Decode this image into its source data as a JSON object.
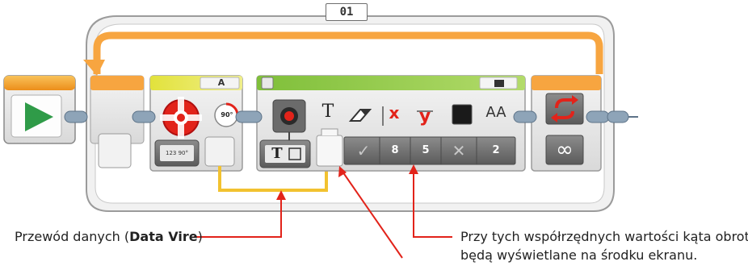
{
  "loop": {
    "label": "01"
  },
  "motor_block": {
    "port": "A",
    "degrees_badge": "90°",
    "mode_icon_text": "123 90°"
  },
  "display_block": {
    "header_icon": "brick-display-icon",
    "mode_letter": "T",
    "params": [
      {
        "icon": "T",
        "value": ""
      },
      {
        "icon": "eraser",
        "value": "✓"
      },
      {
        "icon": "x",
        "value": "8"
      },
      {
        "icon": "y",
        "value": "5"
      },
      {
        "icon": "color",
        "value": "✕"
      },
      {
        "icon": "AA",
        "value": "2"
      }
    ]
  },
  "end_block": {
    "icon": "loop-interrupt-icon",
    "value": "∞"
  },
  "captions": {
    "wire_prefix": "Przewód danych (",
    "wire_bold": "Data Vire",
    "wire_suffix": ")",
    "coords_line1": "Przy tych współrzędnych wartości kąta obrotu",
    "coords_line2": "będą wyświetlane na środku ekranu."
  },
  "colors": {
    "loop_orange": "#f7a540",
    "motor_yellow": "#e8e23a",
    "display_green": "#8cc63f",
    "start_orange": "#f5a623",
    "wire_yellow": "#f2c230",
    "annotation_red": "#e2231a",
    "block_gray": "#e9e9e9"
  }
}
